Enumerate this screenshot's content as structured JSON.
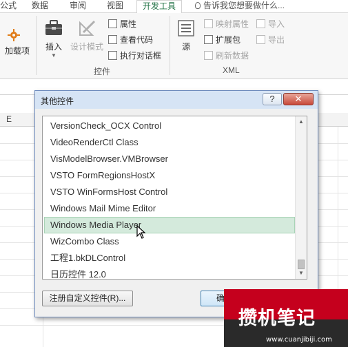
{
  "ribbon_tabs": [
    {
      "label": "公式"
    },
    {
      "label": "数据"
    },
    {
      "label": "审阅"
    },
    {
      "label": "视图"
    },
    {
      "label": "开发工具"
    }
  ],
  "tell_me": "告诉我您想要做什么...",
  "ribbon": {
    "addin_label": "加载项",
    "insert_label": "插入",
    "design_mode_label": "设计模式",
    "properties_label": "属性",
    "view_code_label": "查看代码",
    "run_dialog_label": "执行对话框",
    "controls_group_label": "控件",
    "source_label": "源",
    "map_properties_label": "映射属性",
    "expansion_pack_label": "扩展包",
    "refresh_data_label": "刷新数据",
    "import_label": "导入",
    "export_label": "导出",
    "xml_group_label": "XML"
  },
  "sheet": {
    "column_label": "E"
  },
  "dialog": {
    "title": "其他控件",
    "help_label": "?",
    "close_label": "✕",
    "items": [
      {
        "label": "VersionCheck_OCX Control"
      },
      {
        "label": "VideoRenderCtl Class"
      },
      {
        "label": "VisModelBrowser.VMBrowser"
      },
      {
        "label": "VSTO FormRegionsHostX"
      },
      {
        "label": "VSTO WinFormsHost Control"
      },
      {
        "label": "Windows Mail Mime Editor"
      },
      {
        "label": "Windows Media Player"
      },
      {
        "label": "WizCombo Class"
      },
      {
        "label": "工程1.bkDLControl"
      },
      {
        "label": "日历控件 12.0"
      }
    ],
    "selected_item": "Windows Media Player",
    "register_button": "注册自定义控件(R)...",
    "ok_button": "确"
  },
  "watermark": {
    "text": "攒机笔记",
    "url": "www.cuanjibiji.com"
  },
  "colors": {
    "accent": "#217346",
    "selection": "#d4eadc",
    "watermark_red": "#c5001d"
  }
}
